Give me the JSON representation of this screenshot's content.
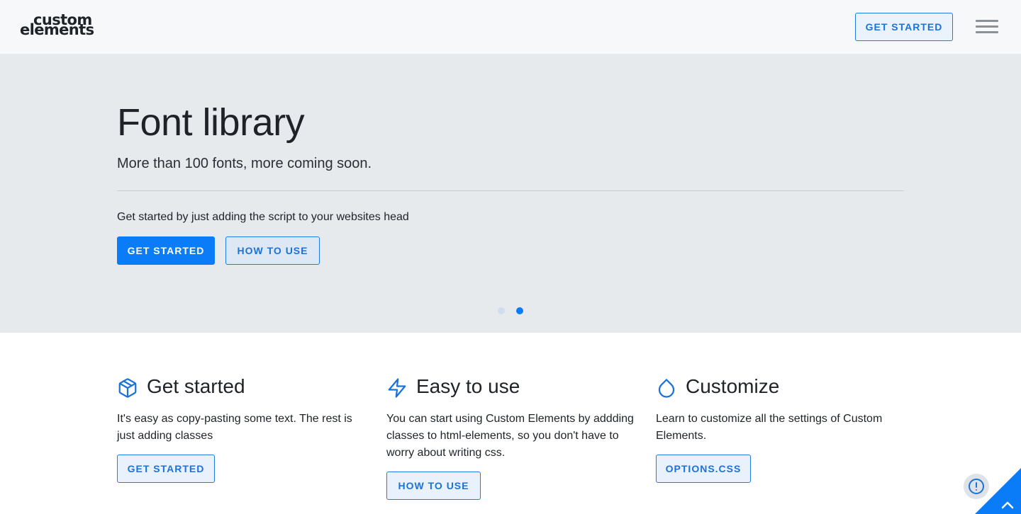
{
  "header": {
    "logo_line1": "custom",
    "logo_line2": "elements",
    "cta_label": "GET STARTED",
    "menu_icon": "hamburger-icon"
  },
  "hero": {
    "title": "Font library",
    "subtitle": "More than 100 fonts, more coming soon.",
    "text": "Get started by just adding the script to your websites head",
    "primary_button": "GET STARTED",
    "secondary_button": "HOW TO USE",
    "slides": {
      "count": 2,
      "active": 2
    }
  },
  "features": [
    {
      "icon": "box-icon",
      "title": "Get started",
      "description": "It's easy as copy-pasting some text. The rest is just adding classes",
      "button": "GET STARTED"
    },
    {
      "icon": "lightning-icon",
      "title": "Easy to use",
      "description": "You can start using Custom Elements by addding classes to html-elements, so you don't have to worry about writing css.",
      "button": "HOW TO USE"
    },
    {
      "icon": "droplet-icon",
      "title": "Customize",
      "description": "Learn to customize all the settings of Custom Elements.",
      "button": "OPTIONS.CSS"
    }
  ],
  "floating": {
    "alert_icon": "alert-circle-icon",
    "scroll_icon": "chevron-up-icon"
  },
  "colors": {
    "accent": "#0a7cf7",
    "header_bg": "#f6f8fa",
    "hero_bg": "#e7eaed"
  }
}
